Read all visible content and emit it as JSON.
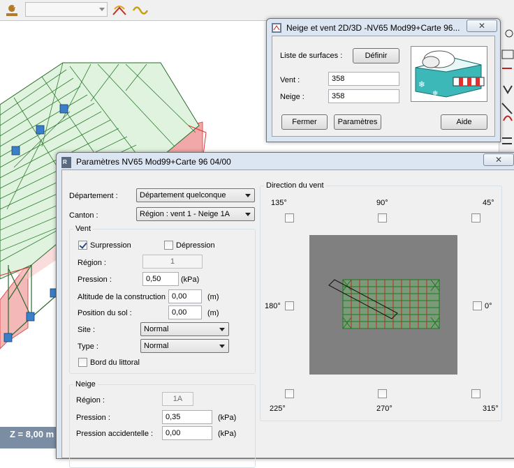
{
  "toolbar": {
    "combo_value": "",
    "zoom_readout": "Z = 8,00 m"
  },
  "snow_wind_window": {
    "title": "Neige et vent 2D/3D -NV65 Mod99+Carte 96...",
    "close": "✕",
    "surfaces_label": "Liste de surfaces :",
    "define_button": "Définir",
    "wind_label": "Vent :",
    "wind_value": "358",
    "snow_label": "Neige :",
    "snow_value": "358",
    "close_button": "Fermer",
    "params_button": "Paramètres",
    "help_button": "Aide"
  },
  "params_window": {
    "title": "Paramètres  NV65 Mod99+Carte 96 04/00",
    "close": "✕",
    "department_label": "Département :",
    "department_value": "Département quelconque",
    "canton_label": "Canton :",
    "canton_value": "Région : vent 1 - Neige 1A",
    "wind_group": {
      "title": "Vent",
      "surpression_label": "Surpression",
      "surpression_checked": true,
      "depression_label": "Dépression",
      "depression_checked": false,
      "region_label": "Région :",
      "region_value": "1",
      "pressure_label": "Pression :",
      "pressure_value": "0,50",
      "pressure_unit": "(kPa)",
      "altitude_label": "Altitude de la construction :",
      "altitude_value": "0,00",
      "altitude_unit": "(m)",
      "ground_label": "Position du sol :",
      "ground_value": "0,00",
      "ground_unit": "(m)",
      "site_label": "Site :",
      "site_value": "Normal",
      "type_label": "Type :",
      "type_value": "Normal",
      "coast_label": "Bord du littoral",
      "coast_checked": false
    },
    "snow_group": {
      "title": "Neige",
      "region_label": "Région :",
      "region_value": "1A",
      "pressure_label": "Pression :",
      "pressure_value": "0,35",
      "pressure_unit": "(kPa)",
      "acc_pressure_label": "Pression accidentelle :",
      "acc_pressure_value": "0,00",
      "acc_pressure_unit": "(kPa)"
    },
    "direction_group": {
      "title": "Direction du vent",
      "d135": "135°",
      "d90": "90°",
      "d45": "45°",
      "d180": "180°",
      "d0": "0°",
      "d225": "225°",
      "d270": "270°",
      "d315": "315°"
    }
  }
}
